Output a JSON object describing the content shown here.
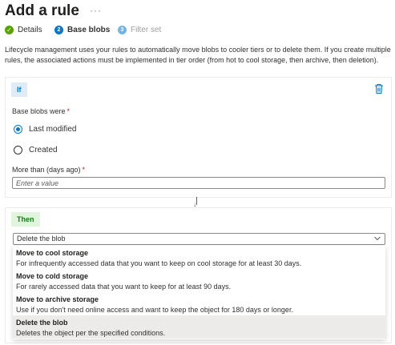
{
  "header": {
    "title": "Add a rule",
    "more": "···"
  },
  "steps": [
    {
      "label": "Details",
      "state": "done",
      "marker": "✓"
    },
    {
      "label": "Base blobs",
      "state": "current",
      "marker": "2"
    },
    {
      "label": "Filter set",
      "state": "upcoming",
      "marker": "3"
    }
  ],
  "description": "Lifecycle management uses your rules to automatically move blobs to cooler tiers or to delete them. If you create multiple rules, the associated actions must be implemented in tier order (from hot to cool storage, then archive, then deletion).",
  "if_card": {
    "badge": "If",
    "base_label": "Base blobs were",
    "required": "*",
    "options": [
      {
        "label": "Last modified",
        "selected": true
      },
      {
        "label": "Created",
        "selected": false
      }
    ],
    "days_label": "More than (days ago)",
    "days_placeholder": "Enter a value",
    "days_value": ""
  },
  "then_card": {
    "badge": "Then",
    "action_selected": "Delete the blob",
    "action_options": [
      {
        "title": "Move to cool storage",
        "description": "For infrequently accessed data that you want to keep on cool storage for at least 30 days.",
        "selected": false
      },
      {
        "title": "Move to cold storage",
        "description": "For rarely accessed data that you want to keep for at least 90 days.",
        "selected": false
      },
      {
        "title": "Move to archive storage",
        "description": "Use if you don't need online access and want to keep the object for 180 days or longer.",
        "selected": false
      },
      {
        "title": "Delete the blob",
        "description": "Deletes the object per the specified conditions.",
        "selected": true
      }
    ]
  },
  "colors": {
    "accent": "#0078d4",
    "success": "#57a300",
    "required": "#a4262c",
    "then_badge_bg": "#dff6dd",
    "if_badge_bg": "#deecf9",
    "selected_option_bg": "#edebe9"
  },
  "icons": {
    "more": "more-horizontal-icon",
    "delete": "trash-icon",
    "chevron": "chevron-down-icon",
    "flow": "arrow-down-icon"
  }
}
